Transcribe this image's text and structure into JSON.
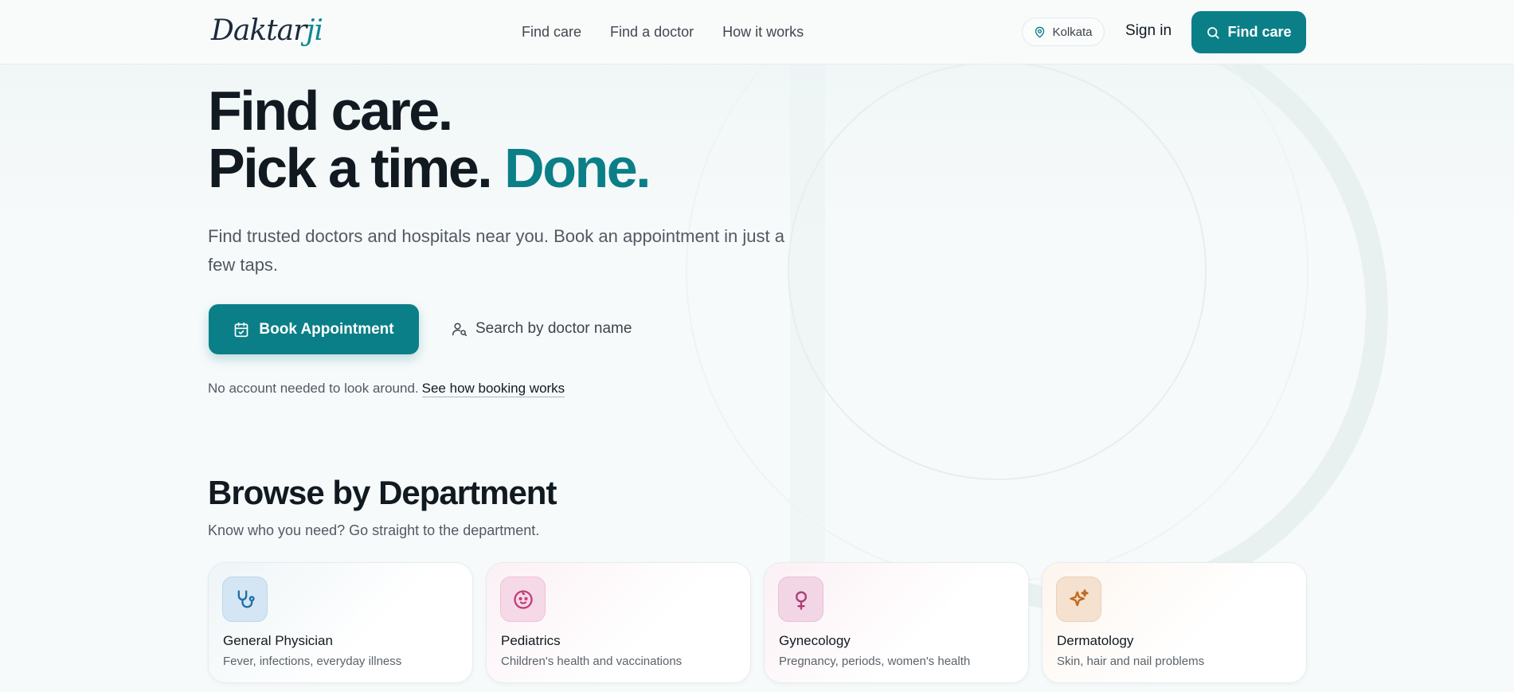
{
  "brand": {
    "logo_main": "Daktar",
    "logo_accent": "ji"
  },
  "nav": {
    "items": [
      "Find care",
      "Find a doctor",
      "How it works"
    ]
  },
  "header": {
    "location": "Kolkata",
    "sign_in": "Sign in",
    "find_care_button": "Find care"
  },
  "hero": {
    "line1": "Find care.",
    "line2": "Pick a time.",
    "accent": "Done.",
    "subtitle": "Find trusted doctors and hospitals near you. Book an appointment in just a few taps.",
    "book_button": "Book Appointment",
    "search_link": "Search by doctor name",
    "note": "No account needed to look around.",
    "note_link": "See how booking works"
  },
  "departments": {
    "title": "Browse by Department",
    "subtitle": "Know who you need? Go straight to the department.",
    "items": [
      {
        "name": "General Physician",
        "desc": "Fever, infections, everyday illness",
        "icon": "stethoscope-icon",
        "color": "#1f6fa8"
      },
      {
        "name": "Pediatrics",
        "desc": "Children's health and vaccinations",
        "icon": "baby-face-icon",
        "color": "#c0407a"
      },
      {
        "name": "Gynecology",
        "desc": "Pregnancy, periods, women's health",
        "icon": "female-symbol-icon",
        "color": "#b03c78"
      },
      {
        "name": "Dermatology",
        "desc": "Skin, hair and nail problems",
        "icon": "sparkles-icon",
        "color": "#c06a1e"
      }
    ]
  },
  "colors": {
    "primary": "#0b7f87",
    "text": "#111a20",
    "muted": "#515a62"
  }
}
